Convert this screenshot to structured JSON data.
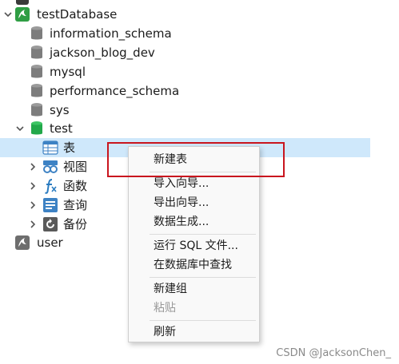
{
  "tree": {
    "connection": {
      "label": "testDatabase"
    },
    "databases": [
      {
        "label": "information_schema"
      },
      {
        "label": "jackson_blog_dev"
      },
      {
        "label": "mysql"
      },
      {
        "label": "performance_schema"
      },
      {
        "label": "sys"
      }
    ],
    "open_database": {
      "label": "test"
    },
    "children": [
      {
        "label": "表",
        "icon": "table-icon"
      },
      {
        "label": "视图",
        "icon": "view-icon"
      },
      {
        "label": "函数",
        "icon": "function-icon"
      },
      {
        "label": "查询",
        "icon": "query-icon"
      },
      {
        "label": "备份",
        "icon": "backup-icon"
      }
    ],
    "second_connection": {
      "label": "user"
    }
  },
  "context_menu": {
    "items": [
      {
        "label": "新建表",
        "enabled": true
      },
      {
        "label": "导入向导...",
        "enabled": true
      },
      {
        "label": "导出向导...",
        "enabled": true
      },
      {
        "label": "数据生成...",
        "enabled": true
      },
      {
        "label": "运行 SQL 文件...",
        "enabled": true
      },
      {
        "label": "在数据库中查找",
        "enabled": true
      },
      {
        "label": "新建组",
        "enabled": true
      },
      {
        "label": "粘贴",
        "enabled": false
      },
      {
        "label": "刷新",
        "enabled": true
      }
    ]
  },
  "watermark": "CSDN @JacksonChen_",
  "colors": {
    "selection": "#cfe8fb",
    "highlight_box": "#c9151e",
    "db_open": "#22a84a",
    "db_closed": "#8c8c8c",
    "connection_icon": "#2f9e44"
  }
}
